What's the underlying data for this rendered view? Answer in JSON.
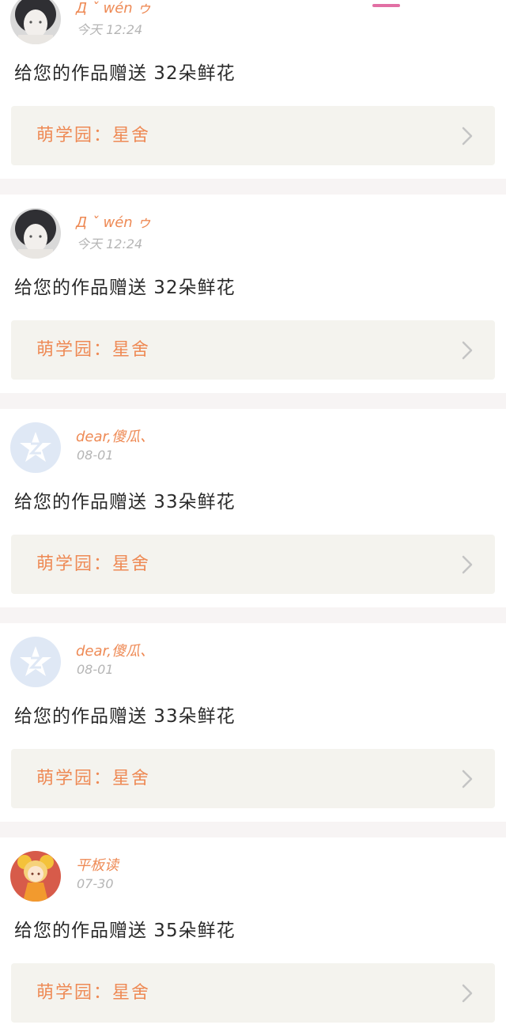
{
  "colors": {
    "accent": "#ee8a55",
    "tab_indicator": "#e26fa4",
    "work_bg": "#f4f3ee",
    "separator": "#f7f4f4"
  },
  "notifications": [
    {
      "avatar": "photo-avatar",
      "name": "Д ˇ wén ゥ",
      "time": "今天 12:24",
      "message": "给您的作品赠送 32朵鲜花",
      "work_label": "萌学园：星舍"
    },
    {
      "avatar": "photo-avatar",
      "name": "Д ˇ wén ゥ",
      "time": "今天 12:24",
      "message": "给您的作品赠送 32朵鲜花",
      "work_label": "萌学园：星舍"
    },
    {
      "avatar": "qzone-default-avatar",
      "name": "dear,傻瓜、",
      "time": "08-01",
      "message": "给您的作品赠送 33朵鲜花",
      "work_label": "萌学园：星舍"
    },
    {
      "avatar": "qzone-default-avatar",
      "name": "dear,傻瓜、",
      "time": "08-01",
      "message": "给您的作品赠送 33朵鲜花",
      "work_label": "萌学园：星舍"
    },
    {
      "avatar": "anime-avatar",
      "name": "平板读",
      "time": "07-30",
      "message": "给您的作品赠送 35朵鲜花",
      "work_label": "萌学园：星舍"
    }
  ]
}
